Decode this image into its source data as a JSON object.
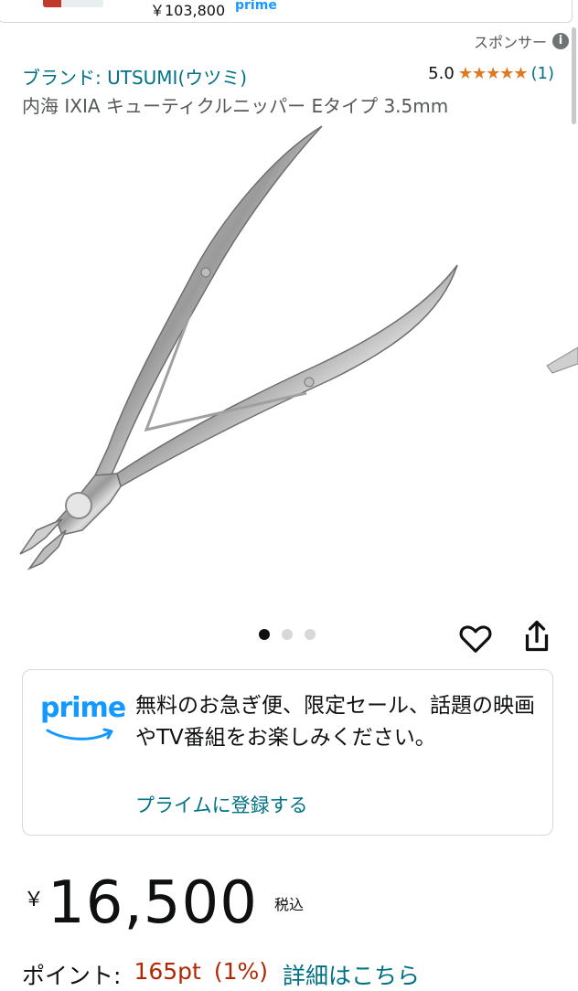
{
  "top_card": {
    "price": "￥103,800",
    "prime_label": "prime"
  },
  "sponsored": {
    "label": "スポンサー",
    "info_icon": "i"
  },
  "product": {
    "brand": "ブランド: UTSUMI(ウツミ)",
    "rating_value": "5.0",
    "stars": "★★★★★",
    "rating_count": "(1)",
    "title": "内海 IXIA キューティクルニッパー Eタイプ 3.5mm"
  },
  "carousel": {
    "total": 3,
    "active": 1
  },
  "prime_promo": {
    "logo_word": "prime",
    "text": "無料のお急ぎ便、限定セール、話題の映画やTV番組をお楽しみください。",
    "link": "プライムに登録する"
  },
  "price": {
    "currency": "￥",
    "amount": "16,500",
    "tax_label": "税込"
  },
  "points": {
    "label": "ポイント:",
    "value": "165pt",
    "percent": "(1%)",
    "details_link": "詳細はこちら"
  },
  "colors": {
    "link": "#007185",
    "star": "#de7921",
    "price_red": "#b12704",
    "prime_blue": "#1399ff"
  }
}
